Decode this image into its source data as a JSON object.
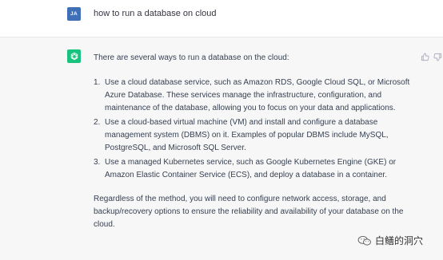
{
  "user_message": {
    "avatar_initials": "JA",
    "text": "how to run a database on cloud"
  },
  "assistant_message": {
    "intro": "There are several ways to run a database on the cloud:",
    "steps": [
      {
        "number": "1.",
        "text": "Use a cloud database service, such as Amazon RDS, Google Cloud SQL, or Microsoft Azure Database. These services manage the infrastructure, configuration, and maintenance of the database, allowing you to focus on your data and applications."
      },
      {
        "number": "2.",
        "text": "Use a cloud-based virtual machine (VM) and install and configure a database management system (DBMS) on it. Examples of popular DBMS include MySQL, PostgreSQL, and Microsoft SQL Server."
      },
      {
        "number": "3.",
        "text": "Use a managed Kubernetes service, such as Google Kubernetes Engine (GKE) or Amazon Elastic Container Service (ECS), and deploy a database in a container."
      }
    ],
    "closing": "Regardless of the method, you will need to configure network access, storage, and backup/recovery options to ensure the reliability and availability of your database on the cloud."
  },
  "feedback": {
    "thumbs_up_icon": "thumbs-up-icon",
    "thumbs_down_icon": "thumbs-down-icon"
  },
  "watermark": {
    "text": "白鳝的洞穴",
    "icon": "wechat-icon"
  },
  "colors": {
    "user_avatar": "#3f6fb7",
    "assistant_avatar": "#19c37d",
    "assistant_background": "#f7f7f8",
    "text": "#374151"
  }
}
